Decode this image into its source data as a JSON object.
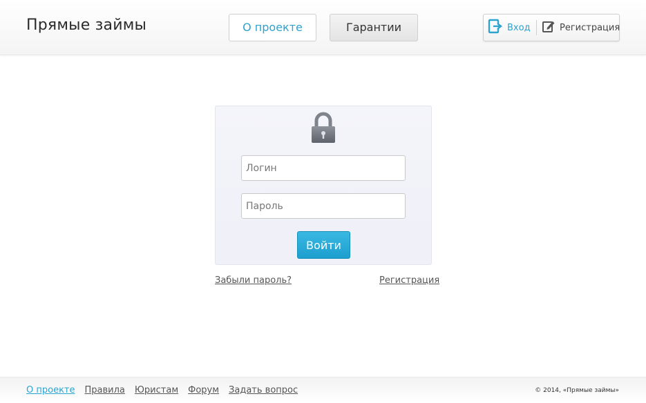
{
  "header": {
    "logo": "Прямые займы",
    "nav": {
      "about": "О проекте",
      "guarantees": "Гарантии"
    },
    "auth": {
      "login": "Вход",
      "register": "Регистрация"
    }
  },
  "login_form": {
    "login_placeholder": "Логин",
    "password_placeholder": "Пароль",
    "submit_label": "Войти",
    "forgot_link": "Забыли пароль?",
    "register_link": "Регистрация"
  },
  "footer": {
    "links": [
      "О проекте",
      "Правила",
      "Юристам",
      "Форум",
      "Задать вопрос"
    ],
    "copyright": "© 2014, «Прямые займы»"
  },
  "colors": {
    "accent": "#2aa3cf",
    "button": "#1c9fcf"
  }
}
